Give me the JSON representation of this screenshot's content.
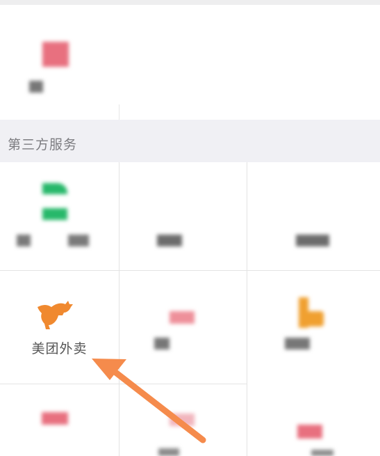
{
  "section": {
    "title": "第三方服务"
  },
  "services": [
    {
      "label": "美团外卖",
      "icon": "kangaroo-icon",
      "icon_color": "#f0892f"
    }
  ],
  "colors": {
    "accent_green": "#27b86a",
    "accent_red": "#e8707f",
    "accent_orange": "#f0892f",
    "arrow": "#f58b4c",
    "header_bg": "#f0f0f4"
  }
}
